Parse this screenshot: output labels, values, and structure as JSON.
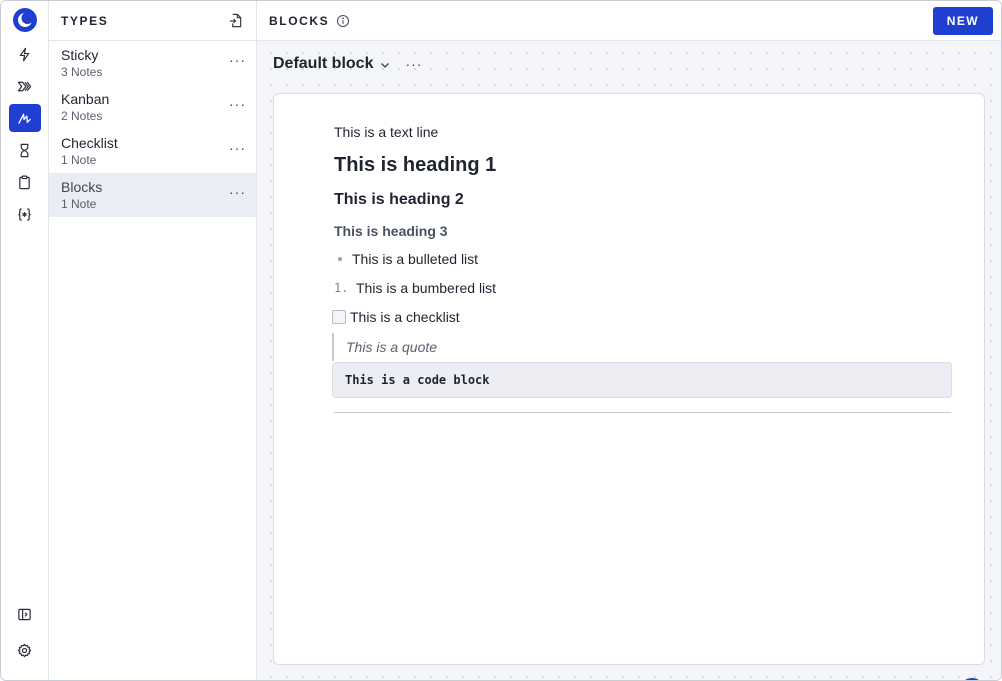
{
  "rail": {
    "items": [
      {
        "icon": "bolt-icon"
      },
      {
        "icon": "forward-icon"
      },
      {
        "icon": "blocks-icon",
        "active": true
      },
      {
        "icon": "hourglass-icon"
      },
      {
        "icon": "clipboard-icon"
      },
      {
        "icon": "braces-icon"
      }
    ],
    "bottom": [
      {
        "icon": "panel-toggle-icon"
      },
      {
        "icon": "settings-icon"
      }
    ]
  },
  "types": {
    "title": "TYPES",
    "items": [
      {
        "name": "Sticky",
        "count": "3 Notes"
      },
      {
        "name": "Kanban",
        "count": "2 Notes"
      },
      {
        "name": "Checklist",
        "count": "1 Note"
      },
      {
        "name": "Blocks",
        "count": "1 Note",
        "active": true
      }
    ],
    "more": "···"
  },
  "main": {
    "title": "BLOCKS",
    "new_label": "NEW",
    "block_title": "Default block",
    "more": "···",
    "content": {
      "text_line": "This is a text line",
      "heading1": "This is heading 1",
      "heading2": "This is heading 2",
      "heading3": "This is heading 3",
      "bulleted": "This is a bulleted list",
      "numbered_marker": "1.",
      "numbered": "This is a bumbered list",
      "checklist": "This is a checklist",
      "quote": "This is a quote",
      "code": "This is a code block"
    },
    "help_label": "?"
  },
  "colors": {
    "accent": "#1f3fd1",
    "selected_bg": "#eaedf3",
    "canvas_bg": "#f4f5f8"
  }
}
